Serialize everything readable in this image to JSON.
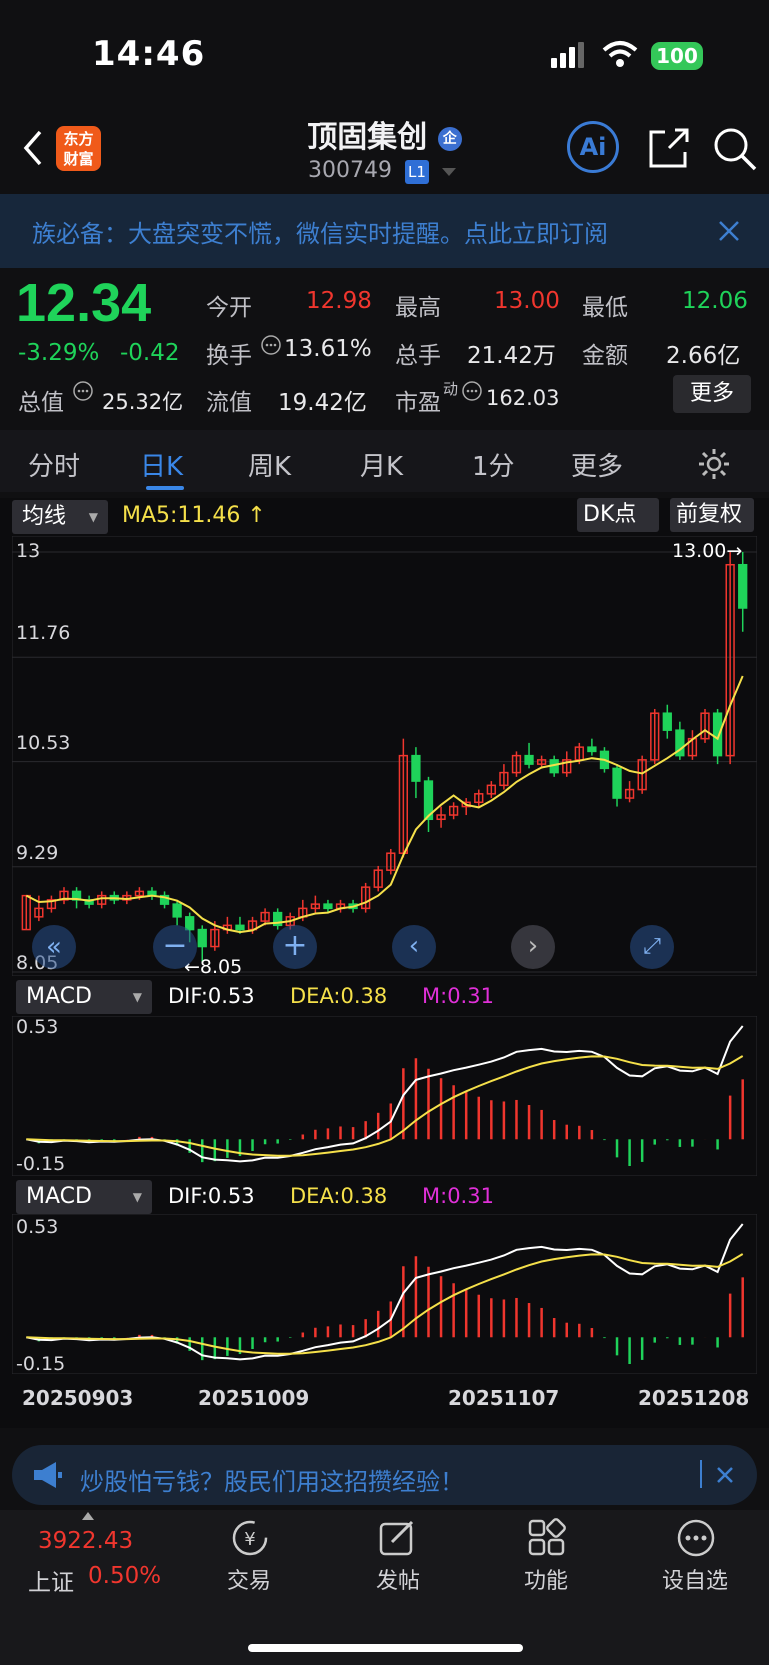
{
  "status_bar": {
    "time": "14:46",
    "battery": "100"
  },
  "header": {
    "logo_line1": "东方",
    "logo_line2": "财富",
    "stock_name": "顶固集创",
    "badge": "企",
    "stock_code": "300749",
    "level": "L1",
    "ai_label": "Ai"
  },
  "banner": {
    "text": "族必备：大盘突变不慌，微信实时提醒。点此立即订阅"
  },
  "quote": {
    "price": "12.34",
    "change_pct": "-3.29%",
    "change": "-0.42",
    "open_label": "今开",
    "open": "12.98",
    "high_label": "最高",
    "high": "13.00",
    "low_label": "最低",
    "low": "12.06",
    "turnover_label": "换手",
    "turnover": "13.61%",
    "volume_label": "总手",
    "volume": "21.42万",
    "amount_label": "金额",
    "amount": "2.66亿",
    "mktcap_label": "总值",
    "mktcap": "25.32亿",
    "float_label": "流值",
    "float_cap": "19.42亿",
    "pe_label": "市盈",
    "pe_sup": "动",
    "pe": "162.03",
    "more": "更多"
  },
  "tabs": [
    "分时",
    "日K",
    "周K",
    "月K",
    "1分",
    "更多"
  ],
  "active_tab": "日K",
  "kline_toolbar": {
    "ma_select": "均线",
    "ma5": "MA5:11.46",
    "dk": "DK点",
    "adjust": "前复权"
  },
  "macd_panels": [
    {
      "select": "MACD",
      "dif": "DIF:0.53",
      "dea": "DEA:0.38",
      "m": "M:0.31",
      "top": "0.53",
      "bottom": "-0.15"
    },
    {
      "select": "MACD",
      "dif": "DIF:0.53",
      "dea": "DEA:0.38",
      "m": "M:0.31",
      "top": "0.53",
      "bottom": "-0.15"
    }
  ],
  "dates": [
    "20250903",
    "20251009",
    "20251107",
    "20251208"
  ],
  "notice": {
    "text": "炒股怕亏钱？股民们用这招攒经验！"
  },
  "bottom_nav": {
    "index_value": "3922.43",
    "index_name": "上证",
    "index_change": "0.50%",
    "items": [
      "交易",
      "发帖",
      "功能",
      "设自选"
    ]
  },
  "colors": {
    "up": "#f0362e",
    "down": "#1fd35a",
    "accent": "#3a87e8",
    "ma": "#f5e04a"
  },
  "chart_data": {
    "type": "candlestick",
    "title": "",
    "y_axis_ticks": [
      13.0,
      11.76,
      10.53,
      9.29,
      8.05
    ],
    "ylim": [
      8.05,
      13.0
    ],
    "annotations": [
      "13.00",
      "8.05"
    ],
    "x_tick_labels": [
      "20250903",
      "20251009",
      "20251107",
      "20251208"
    ],
    "series": [
      {
        "name": "MA5",
        "last": 11.46
      },
      {
        "name": "K",
        "ohlc": [
          [
            8.55,
            8.95,
            8.95,
            8.55
          ],
          [
            8.7,
            8.8,
            8.95,
            8.65
          ],
          [
            8.8,
            8.9,
            8.95,
            8.75
          ],
          [
            8.9,
            9.0,
            9.05,
            8.85
          ],
          [
            9.0,
            8.9,
            9.05,
            8.8
          ],
          [
            8.9,
            8.85,
            8.95,
            8.8
          ],
          [
            8.85,
            8.95,
            9.0,
            8.8
          ],
          [
            8.95,
            8.9,
            9.0,
            8.85
          ],
          [
            8.9,
            8.95,
            9.0,
            8.85
          ],
          [
            8.95,
            9.0,
            9.05,
            8.9
          ],
          [
            9.0,
            8.95,
            9.05,
            8.9
          ],
          [
            8.95,
            8.85,
            9.0,
            8.8
          ],
          [
            8.85,
            8.7,
            8.9,
            8.6
          ],
          [
            8.7,
            8.55,
            8.75,
            8.4
          ],
          [
            8.55,
            8.35,
            8.6,
            8.15
          ],
          [
            8.35,
            8.55,
            8.65,
            8.3
          ],
          [
            8.55,
            8.6,
            8.7,
            8.5
          ],
          [
            8.6,
            8.55,
            8.7,
            8.5
          ],
          [
            8.55,
            8.65,
            8.7,
            8.5
          ],
          [
            8.65,
            8.75,
            8.8,
            8.6
          ],
          [
            8.75,
            8.6,
            8.8,
            8.55
          ],
          [
            8.6,
            8.7,
            8.75,
            8.55
          ],
          [
            8.7,
            8.8,
            8.9,
            8.65
          ],
          [
            8.8,
            8.85,
            8.95,
            8.75
          ],
          [
            8.85,
            8.8,
            8.9,
            8.75
          ],
          [
            8.8,
            8.85,
            8.9,
            8.75
          ],
          [
            8.85,
            8.8,
            8.9,
            8.75
          ],
          [
            8.8,
            9.05,
            9.1,
            8.75
          ],
          [
            9.05,
            9.25,
            9.3,
            9.0
          ],
          [
            9.25,
            9.45,
            9.5,
            9.2
          ],
          [
            9.45,
            10.6,
            10.8,
            9.4
          ],
          [
            10.6,
            10.3,
            10.7,
            10.1
          ],
          [
            10.3,
            9.85,
            10.35,
            9.7
          ],
          [
            9.85,
            9.9,
            10.0,
            9.75
          ],
          [
            9.9,
            10.0,
            10.05,
            9.85
          ],
          [
            10.0,
            10.05,
            10.1,
            9.9
          ],
          [
            10.05,
            10.15,
            10.2,
            10.0
          ],
          [
            10.15,
            10.25,
            10.3,
            10.1
          ],
          [
            10.25,
            10.4,
            10.5,
            10.2
          ],
          [
            10.4,
            10.6,
            10.65,
            10.35
          ],
          [
            10.6,
            10.5,
            10.75,
            10.45
          ],
          [
            10.5,
            10.55,
            10.6,
            10.45
          ],
          [
            10.55,
            10.4,
            10.6,
            10.35
          ],
          [
            10.4,
            10.55,
            10.65,
            10.35
          ],
          [
            10.55,
            10.7,
            10.75,
            10.5
          ],
          [
            10.7,
            10.65,
            10.8,
            10.6
          ],
          [
            10.65,
            10.45,
            10.7,
            10.4
          ],
          [
            10.45,
            10.1,
            10.5,
            10.0
          ],
          [
            10.1,
            10.2,
            10.3,
            10.05
          ],
          [
            10.2,
            10.55,
            10.6,
            10.15
          ],
          [
            10.55,
            11.1,
            11.15,
            10.5
          ],
          [
            11.1,
            10.9,
            11.2,
            10.8
          ],
          [
            10.9,
            10.6,
            11.0,
            10.55
          ],
          [
            10.6,
            10.8,
            10.9,
            10.55
          ],
          [
            10.8,
            11.1,
            11.15,
            10.75
          ],
          [
            11.1,
            10.6,
            11.15,
            10.5
          ],
          [
            10.6,
            12.85,
            13.0,
            10.5
          ],
          [
            12.85,
            12.34,
            13.0,
            12.06
          ]
        ]
      }
    ]
  }
}
